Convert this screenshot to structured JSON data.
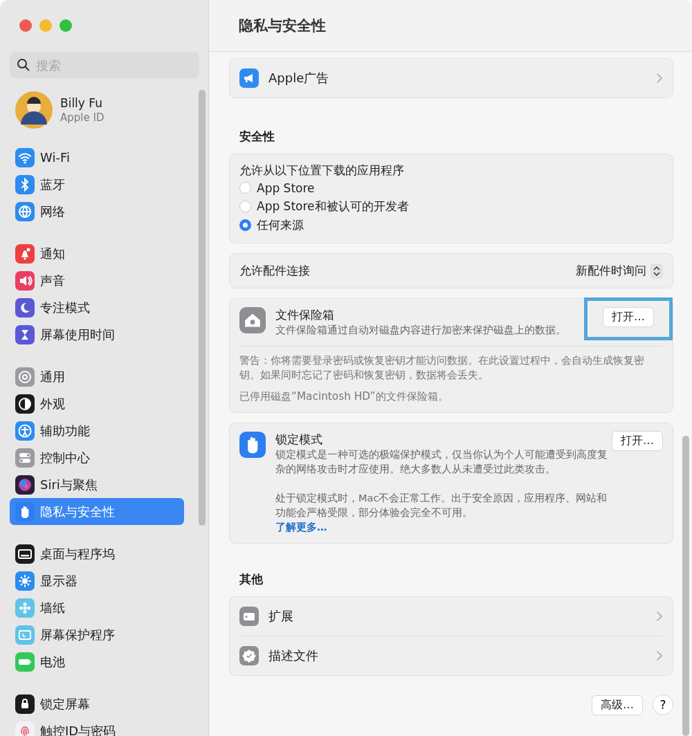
{
  "sidebar": {
    "search": {
      "placeholder": "搜索"
    },
    "account": {
      "name": "Billy Fu",
      "subtitle": "Apple ID"
    },
    "groups": [
      [
        {
          "kind": "wifi",
          "label": "Wi-Fi",
          "selected": false
        },
        {
          "kind": "bluetooth",
          "label": "蓝牙",
          "selected": false
        },
        {
          "kind": "network",
          "label": "网络",
          "selected": false
        }
      ],
      [
        {
          "kind": "notifications",
          "label": "通知",
          "selected": false
        },
        {
          "kind": "sound",
          "label": "声音",
          "selected": false
        },
        {
          "kind": "focus",
          "label": "专注模式",
          "selected": false
        },
        {
          "kind": "screentime",
          "label": "屏幕使用时间",
          "selected": false
        }
      ],
      [
        {
          "kind": "general",
          "label": "通用",
          "selected": false
        },
        {
          "kind": "appearance",
          "label": "外观",
          "selected": false
        },
        {
          "kind": "accessibility",
          "label": "辅助功能",
          "selected": false
        },
        {
          "kind": "control",
          "label": "控制中心",
          "selected": false
        },
        {
          "kind": "siri",
          "label": "Siri与聚焦",
          "selected": false
        },
        {
          "kind": "privacy",
          "label": "隐私与安全性",
          "selected": true
        }
      ],
      [
        {
          "kind": "desktop",
          "label": "桌面与程序坞",
          "selected": false
        },
        {
          "kind": "displays",
          "label": "显示器",
          "selected": false
        },
        {
          "kind": "wallpaper",
          "label": "墙纸",
          "selected": false
        },
        {
          "kind": "screensaver",
          "label": "屏幕保护程序",
          "selected": false
        },
        {
          "kind": "battery",
          "label": "电池",
          "selected": false
        }
      ],
      [
        {
          "kind": "lock",
          "label": "锁定屏幕",
          "selected": false
        },
        {
          "kind": "touchid",
          "label": "触控ID与密码",
          "selected": false
        }
      ]
    ]
  },
  "page_title": "隐私与安全性",
  "privacy_rows": [
    {
      "kind": "ads",
      "label": "Apple广告"
    }
  ],
  "security": {
    "heading": "安全性",
    "downloads": {
      "label": "允许从以下位置下载的应用程序",
      "options": [
        {
          "label": "App Store",
          "selected": false
        },
        {
          "label": "App Store和被认可的开发者",
          "selected": false
        },
        {
          "label": "任何来源",
          "selected": true
        }
      ]
    },
    "accessories": {
      "label": "允许配件连接",
      "value": "新配件时询问"
    },
    "filevault": {
      "title": "文件保险箱",
      "description": "文件保险箱通过自动对磁盘内容进行加密来保护磁盘上的数据。",
      "button": {
        "label": "打开…",
        "highlighted": true
      },
      "warning": "警告：你将需要登录密码或恢复密钥才能访问数据。在此设置过程中，会自动生成恢复密钥。如果同时忘记了密码和恢复密钥，数据将会丢失。",
      "status": "已停用磁盘“Macintosh HD”的文件保险箱。"
    },
    "lockdown": {
      "title": "锁定模式",
      "description": "锁定模式是一种可选的极端保护模式，仅当你认为个人可能遭受到高度复杂的网络攻击时才应使用。绝大多数人从未遭受过此类攻击。",
      "note": "处于锁定模式时，Mac不会正常工作。出于安全原因，应用程序、网站和功能会严格受限，部分体验会完全不可用。",
      "link": "了解更多…",
      "button": {
        "label": "打开…",
        "highlighted": false
      }
    }
  },
  "other": {
    "heading": "其他",
    "rows": [
      {
        "kind": "extensions",
        "label": "扩展"
      },
      {
        "kind": "profiles",
        "label": "描述文件"
      }
    ]
  },
  "footer": {
    "buttons": [
      {
        "kind": "text",
        "label": "高级…"
      },
      {
        "kind": "help",
        "label": "?"
      }
    ]
  }
}
